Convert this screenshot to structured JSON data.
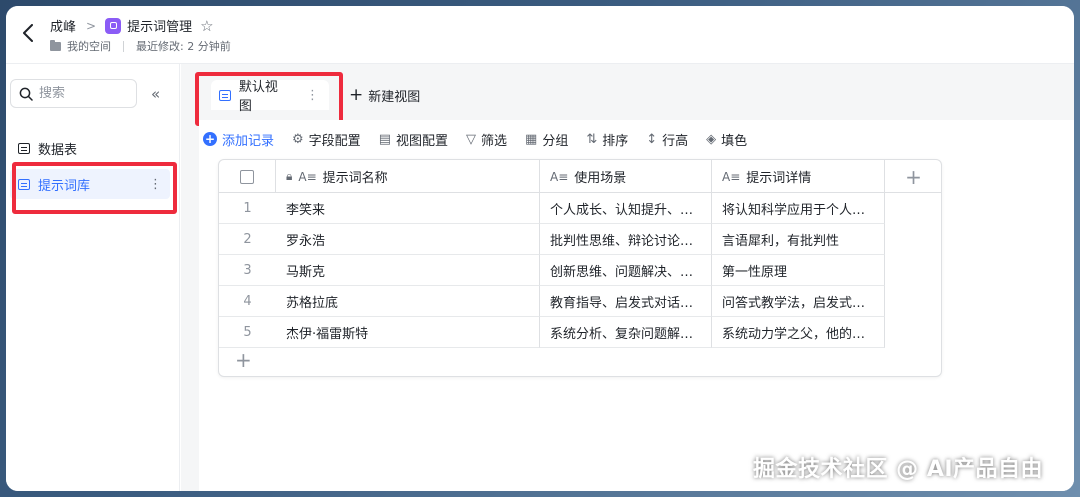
{
  "header": {
    "breadcrumb_parent": "成峰",
    "title": "提示词管理",
    "location": "我的空间",
    "last_modified": "最近修改: 2 分钟前"
  },
  "sidebar": {
    "search_placeholder": "搜索",
    "items": [
      {
        "label": "数据表",
        "active": false
      },
      {
        "label": "提示词库",
        "active": true
      }
    ]
  },
  "views": {
    "active": "默认视图",
    "new_view": "新建视图"
  },
  "toolbar": {
    "add_record": "添加记录",
    "field_config": "字段配置",
    "view_config": "视图配置",
    "filter": "筛选",
    "group": "分组",
    "sort": "排序",
    "row_height": "行高",
    "fill": "填色"
  },
  "table": {
    "columns": [
      "提示词名称",
      "使用场景",
      "提示词详情"
    ],
    "rows": [
      {
        "num": "1",
        "name": "李笑来",
        "scene": "个人成长、认知提升、…",
        "detail": "将认知科学应用于个人…"
      },
      {
        "num": "2",
        "name": "罗永浩",
        "scene": "批判性思维、辩论讨论…",
        "detail": "言语犀利，有批判性"
      },
      {
        "num": "3",
        "name": "马斯克",
        "scene": "创新思维、问题解决、…",
        "detail": "第一性原理"
      },
      {
        "num": "4",
        "name": "苏格拉底",
        "scene": "教育指导、启发式对话…",
        "detail": "问答式教学法，启发式…"
      },
      {
        "num": "5",
        "name": "杰伊·福雷斯特",
        "scene": "系统分析、复杂问题解…",
        "detail": "系统动力学之父，他的…"
      }
    ]
  },
  "colors": {
    "accent": "#3370ff",
    "highlight_box": "#ee2b3d",
    "app_icon": "#8b5cf6"
  },
  "watermark": "掘金技术社区 @ AI产品自由"
}
